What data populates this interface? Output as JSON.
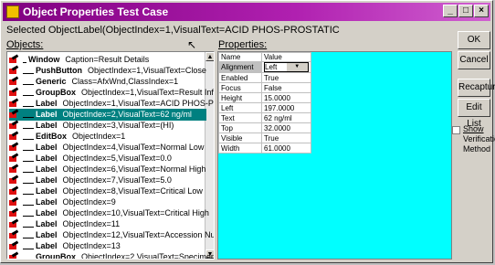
{
  "window": {
    "title": "Object Properties Test Case",
    "buttons": [
      "_",
      "□",
      "×"
    ]
  },
  "selected_object": {
    "label": "Selected Object:",
    "value": "Label(ObjectIndex=1,VisualText=ACID PHOS-PROSTATIC"
  },
  "objects_label": "Objects:",
  "properties_label": "Properties:",
  "objects": [
    {
      "type": "Window",
      "desc": "Caption=Result Details",
      "level": 0
    },
    {
      "type": "PushButton",
      "desc": "ObjectIndex=1,VisualText=Close",
      "level": 1
    },
    {
      "type": "Generic",
      "desc": "Class=AfxWnd,ClassIndex=1",
      "level": 1
    },
    {
      "type": "GroupBox",
      "desc": "ObjectIndex=1,VisualText=Result Info",
      "level": 1
    },
    {
      "type": "Label",
      "desc": "ObjectIndex=1,VisualText=ACID PHOS-PROST",
      "level": 1
    },
    {
      "type": "Label",
      "desc": "ObjectIndex=2,VisualText=62 ng/ml",
      "level": 1,
      "selected": true
    },
    {
      "type": "Label",
      "desc": "ObjectIndex=3,VisualText=(HI)",
      "level": 1
    },
    {
      "type": "EditBox",
      "desc": "ObjectIndex=1",
      "level": 1
    },
    {
      "type": "Label",
      "desc": "ObjectIndex=4,VisualText=Normal Low",
      "level": 1
    },
    {
      "type": "Label",
      "desc": "ObjectIndex=5,VisualText=0.0",
      "level": 1
    },
    {
      "type": "Label",
      "desc": "ObjectIndex=6,VisualText=Normal High",
      "level": 1
    },
    {
      "type": "Label",
      "desc": "ObjectIndex=7,VisualText=5.0",
      "level": 1
    },
    {
      "type": "Label",
      "desc": "ObjectIndex=8,VisualText=Critical Low",
      "level": 1
    },
    {
      "type": "Label",
      "desc": "ObjectIndex=9",
      "level": 1
    },
    {
      "type": "Label",
      "desc": "ObjectIndex=10,VisualText=Critical High",
      "level": 1
    },
    {
      "type": "Label",
      "desc": "ObjectIndex=11",
      "level": 1
    },
    {
      "type": "Label",
      "desc": "ObjectIndex=12,VisualText=Accession Num",
      "level": 1
    },
    {
      "type": "Label",
      "desc": "ObjectIndex=13",
      "level": 1
    },
    {
      "type": "GroupBox",
      "desc": "ObjectIndex=2,VisualText=Specimen",
      "level": 1
    }
  ],
  "properties": {
    "headers": [
      "Name",
      "Value"
    ],
    "rows": [
      {
        "name": "Alignment",
        "value": "Left",
        "combo": true
      },
      {
        "name": "Enabled",
        "value": "True"
      },
      {
        "name": "Focus",
        "value": "False"
      },
      {
        "name": "Height",
        "value": "15.0000"
      },
      {
        "name": "Left",
        "value": "197.0000"
      },
      {
        "name": "Text",
        "value": "62 ng/ml"
      },
      {
        "name": "Top",
        "value": "32.0000"
      },
      {
        "name": "Visible",
        "value": "True"
      },
      {
        "name": "Width",
        "value": "61.0000"
      }
    ]
  },
  "buttons": {
    "ok": "OK",
    "cancel": "Cancel",
    "recapture": "Recapture",
    "edit_list": "Edit List"
  },
  "show_verification": {
    "checked": false,
    "line1": "Show",
    "line2": "Verification",
    "line3": "Method"
  }
}
